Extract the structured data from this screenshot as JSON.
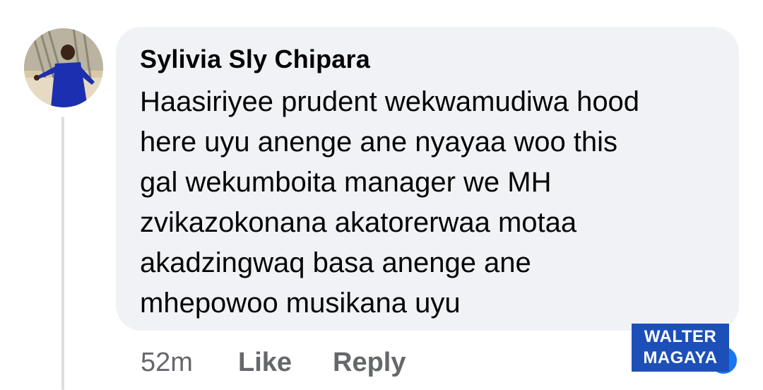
{
  "comment": {
    "author": "Sylivia Sly Chipara",
    "text_lines": [
      "Haasiriyee prudent wekwamudiwa hood",
      "here uyu anenge ane nyayaa woo this",
      "gal wekumboita manager we MH",
      "zvikazokonana akatorerwaa motaa",
      "akadzingwaq basa anenge ane",
      "mhepowoo musikana uyu"
    ],
    "timestamp": "52m",
    "like_label": "Like",
    "reply_label": "Reply"
  },
  "watermark": {
    "line1": "WALTER",
    "line2": "MAGAYA"
  },
  "colors": {
    "bubble": "#f0f2f5",
    "text": "#050505",
    "secondary": "#65676b",
    "watermark_bg": "#1c4fb8",
    "reaction": "#1877f2"
  },
  "icons": {
    "reaction": "like-reaction-icon"
  }
}
